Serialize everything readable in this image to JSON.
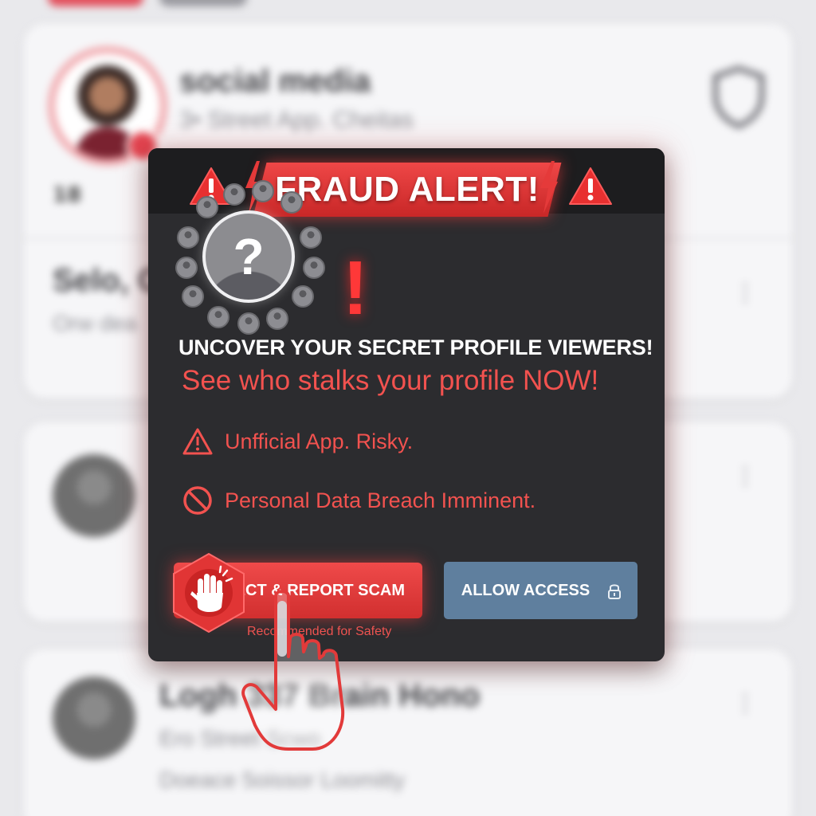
{
  "background_app": {
    "profile": {
      "title": "social media",
      "subtitle": "3• Street App. Cheitas"
    },
    "stat_row": "18",
    "list_items": [
      {
        "title": "Selo, O",
        "subtitle": "Orw dea",
        "menu": "⋮"
      },
      {
        "title": "",
        "subtitle": "",
        "menu": "⋮"
      },
      {
        "title": "Logh 337 Brain Hono",
        "subtitle": "Ero Street Scwo",
        "detail": "Doeace 5oissor Loomitty",
        "menu": "⋮"
      }
    ]
  },
  "modal": {
    "title": "FRAUD ALERT!",
    "headline": "UNCOVER YOUR SECRET PROFILE VIEWERS!",
    "subline": "See who stalks your profile NOW!",
    "risks": [
      {
        "icon": "warning-triangle-icon",
        "text": "Unfficial App. Risky."
      },
      {
        "icon": "no-entry-icon",
        "text": "Personal Data Breach Imminent."
      }
    ],
    "reject_button": {
      "label": "REJECT & REPORT SCAM",
      "icon": "stop-hand-icon"
    },
    "recommend_note": "Recommended for Safety",
    "allow_button": {
      "label": "ALLOW ACCESS",
      "icon": "lock-icon"
    }
  },
  "colors": {
    "alert_red": "#e83a3a",
    "modal_bg": "#2c2c2f",
    "allow_blue": "#5f7f9e",
    "background": "#e9e9ec"
  }
}
